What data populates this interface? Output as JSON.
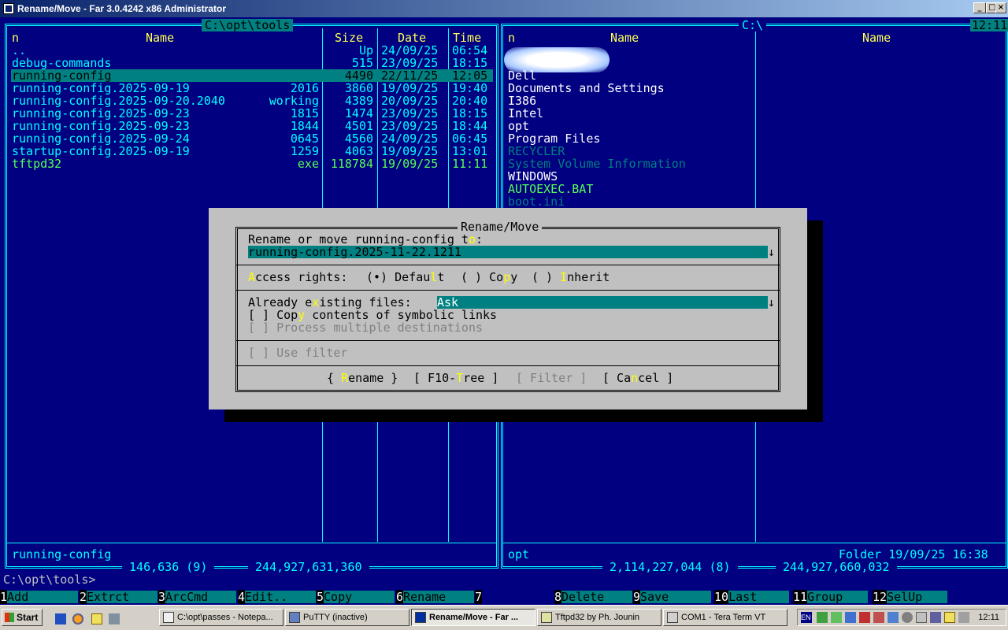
{
  "window": {
    "title": "Rename/Move - Far 3.0.4242 x86 Administrator"
  },
  "left_panel": {
    "path": "C:\\opt\\tools",
    "headers": {
      "n": "n",
      "name": "Name",
      "size": "Size",
      "date": "Date",
      "time": "Time"
    },
    "rows": [
      {
        "name": "..",
        "ext": "",
        "size": "Up",
        "date": "24/09/25",
        "time": "06:54"
      },
      {
        "name": "debug-commands",
        "ext": "",
        "size": "515",
        "date": "23/09/25",
        "time": "18:15"
      },
      {
        "name": "running-config",
        "ext": "",
        "size": "4490",
        "date": "22/11/25",
        "time": "12:05"
      },
      {
        "name": "running-config.2025-09-19",
        "ext": "2016",
        "size": "3860",
        "date": "19/09/25",
        "time": "19:40"
      },
      {
        "name": "running-config.2025-09-20.2040",
        "ext": "working",
        "size": "4389",
        "date": "20/09/25",
        "time": "20:40"
      },
      {
        "name": "running-config.2025-09-23",
        "ext": "1815",
        "size": "1474",
        "date": "23/09/25",
        "time": "18:15"
      },
      {
        "name": "running-config.2025-09-23",
        "ext": "1844",
        "size": "4501",
        "date": "23/09/25",
        "time": "18:44"
      },
      {
        "name": "running-config.2025-09-24",
        "ext": "0645",
        "size": "4560",
        "date": "24/09/25",
        "time": "06:45"
      },
      {
        "name": "startup-config.2025-09-19",
        "ext": "1259",
        "size": "4063",
        "date": "19/09/25",
        "time": "13:01"
      },
      {
        "name": "tftpd32",
        "ext": "exe",
        "size": "118784",
        "date": "19/09/25",
        "time": "11:11"
      }
    ],
    "info": "running-config",
    "totals": " 146,636 (9) ",
    "free": " 244,927,631,360 "
  },
  "right_panel": {
    "path": "C:\\",
    "headers": {
      "n": "n",
      "name1": "Name",
      "name2": "Name"
    },
    "clock": "12:11",
    "items": [
      "Dell",
      "Documents and Settings",
      "I386",
      "Intel",
      "opt",
      "Program Files",
      "RECYCLER",
      "System Volume Information",
      "WINDOWS",
      "AUTOEXEC.BAT",
      "boot.ini"
    ],
    "info_name": "opt",
    "info_right": "Folder 19/09/25 16:38",
    "totals": " 2,114,227,044 (8) ",
    "free": " 244,927,660,032 "
  },
  "dialog": {
    "title": "Rename/Move",
    "prompt": [
      "Rename or move running-config t",
      "o",
      ":"
    ],
    "target_value": "running-config.2025-11-22.1211",
    "access_label": [
      "",
      "A",
      "ccess rights: "
    ],
    "access_default": [
      "(•) Defau",
      "l",
      "t"
    ],
    "access_copy": [
      "( ) Co",
      "p",
      "y"
    ],
    "access_inherit": [
      "( ) ",
      "I",
      "nherit"
    ],
    "existing_label": [
      "Already e",
      "x",
      "isting files: "
    ],
    "existing_value": "Ask",
    "copy_symlinks": [
      "[ ] Cop",
      "y",
      " contents of symbolic links"
    ],
    "multi_dest": "[ ] Process multiple destinations",
    "use_filter": "[ ] Use filter",
    "btn_rename": [
      "{ ",
      "R",
      "ename }"
    ],
    "btn_tree": [
      "[ F10-",
      "T",
      "ree ]"
    ],
    "btn_filter": "[ Filter ]",
    "btn_cancel": [
      "[ Ca",
      "n",
      "cel ]"
    ],
    "arrow": "↓"
  },
  "command_line": "C:\\opt\\tools>",
  "keybar": [
    {
      "num": "1",
      "label": "Add"
    },
    {
      "num": "2",
      "label": "Extrct"
    },
    {
      "num": "3",
      "label": "ArcCmd"
    },
    {
      "num": "4",
      "label": "Edit.."
    },
    {
      "num": "5",
      "label": "Copy"
    },
    {
      "num": "6",
      "label": "Rename"
    },
    {
      "num": "7",
      "label": ""
    },
    {
      "num": "8",
      "label": "Delete"
    },
    {
      "num": "9",
      "label": "Save"
    },
    {
      "num": "10",
      "label": "Last"
    },
    {
      "num": "11",
      "label": "Group"
    },
    {
      "num": "12",
      "label": "SelUp"
    }
  ],
  "taskbar": {
    "start": "Start",
    "buttons": [
      "C:\\opt\\passes - Notepa...",
      "PuTTY (inactive)",
      "Rename/Move - Far ...",
      "Tftpd32 by Ph. Jounin",
      "COM1 - Tera Term VT"
    ],
    "tray_lang": "EN",
    "clock": "12:11"
  },
  "colors": {
    "console_bg": "#000080",
    "cyan": "#00ffff",
    "teal": "#008080",
    "dialog_bg": "#c0c0c0",
    "hotkey": "#ffff00",
    "exec": "#55ff55"
  }
}
